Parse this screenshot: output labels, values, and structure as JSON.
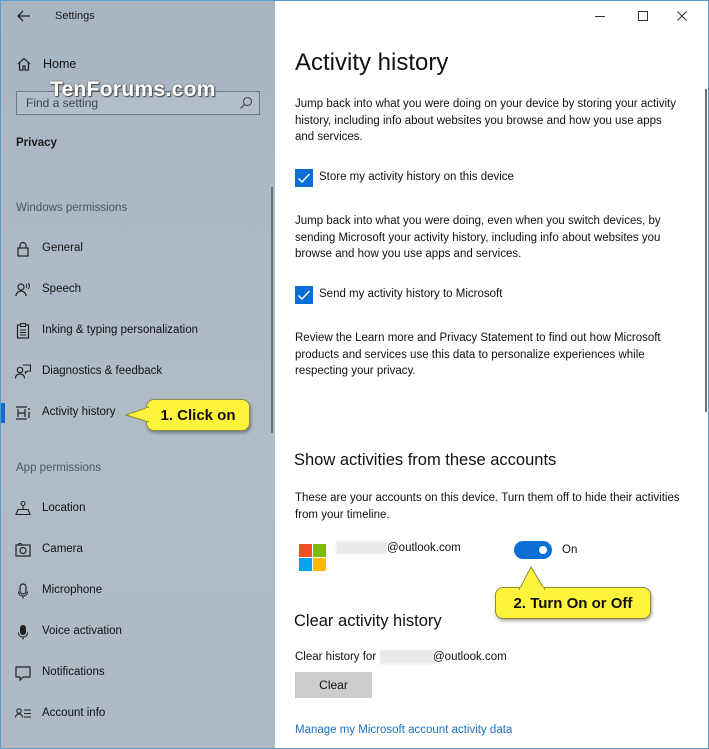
{
  "window": {
    "app_title": "Settings",
    "controls": {
      "minimize": "minimize-icon",
      "maximize": "maximize-icon",
      "close": "close-icon"
    }
  },
  "watermark": "TenForums.com",
  "sidebar": {
    "back_icon": "arrow-left-icon",
    "home": {
      "label": "Home",
      "icon": "home-icon"
    },
    "search": {
      "placeholder": "Find a setting",
      "value": "",
      "icon": "search-icon"
    },
    "section": "Privacy",
    "groups": [
      {
        "label": "Windows permissions",
        "items": [
          {
            "label": "General",
            "icon": "lock-icon",
            "active": false
          },
          {
            "label": "Speech",
            "icon": "speech-icon",
            "active": false
          },
          {
            "label": "Inking & typing personalization",
            "icon": "clipboard-icon",
            "active": false
          },
          {
            "label": "Diagnostics & feedback",
            "icon": "feedback-icon",
            "active": false
          },
          {
            "label": "Activity history",
            "icon": "timeline-icon",
            "active": true
          }
        ]
      },
      {
        "label": "App permissions",
        "items": [
          {
            "label": "Location",
            "icon": "location-icon",
            "active": false
          },
          {
            "label": "Camera",
            "icon": "camera-icon",
            "active": false
          },
          {
            "label": "Microphone",
            "icon": "microphone-icon",
            "active": false
          },
          {
            "label": "Voice activation",
            "icon": "voice-activation-icon",
            "active": false
          },
          {
            "label": "Notifications",
            "icon": "notification-icon",
            "active": false
          },
          {
            "label": "Account info",
            "icon": "account-info-icon",
            "active": false
          }
        ]
      }
    ]
  },
  "callouts": {
    "step1": "1. Click on",
    "step2": "2. Turn On or Off",
    "color": "#fff43c"
  },
  "main": {
    "title": "Activity history",
    "intro": "Jump back into what you were doing on your device by storing your activity history, including info about websites you browse and how you use apps and services.",
    "store_checkbox": {
      "label": "Store my activity history on this device",
      "checked": true
    },
    "send_para": "Jump back into what you were doing, even when you switch devices, by sending Microsoft your activity history, including info about websites you browse and how you use apps and services.",
    "send_checkbox": {
      "label": "Send my activity history to Microsoft",
      "checked": true
    },
    "privacy_para": "Review the Learn more and Privacy Statement to find out how Microsoft products and services use this data to personalize experiences while respecting your privacy.",
    "accounts": {
      "heading": "Show activities from these accounts",
      "description": "These are your accounts on this device. Turn them off to hide their activities from your timeline.",
      "items": [
        {
          "email_suffix": "@outlook.com",
          "toggle_on": true,
          "toggle_label": "On",
          "icon": "microsoft-logo-icon"
        }
      ]
    },
    "clear": {
      "heading": "Clear activity history",
      "label_prefix": "Clear history for",
      "email_suffix": "@outlook.com",
      "button": "Clear"
    },
    "manage_link": "Manage my Microsoft account activity data"
  },
  "colors": {
    "accent": "#0a6fd4",
    "sidebar_bg": "#aab6c2",
    "link": "#1a73c2",
    "ms_red": "#f25022",
    "ms_green": "#7fba00",
    "ms_blue": "#00a4ef",
    "ms_yellow": "#ffb900"
  }
}
